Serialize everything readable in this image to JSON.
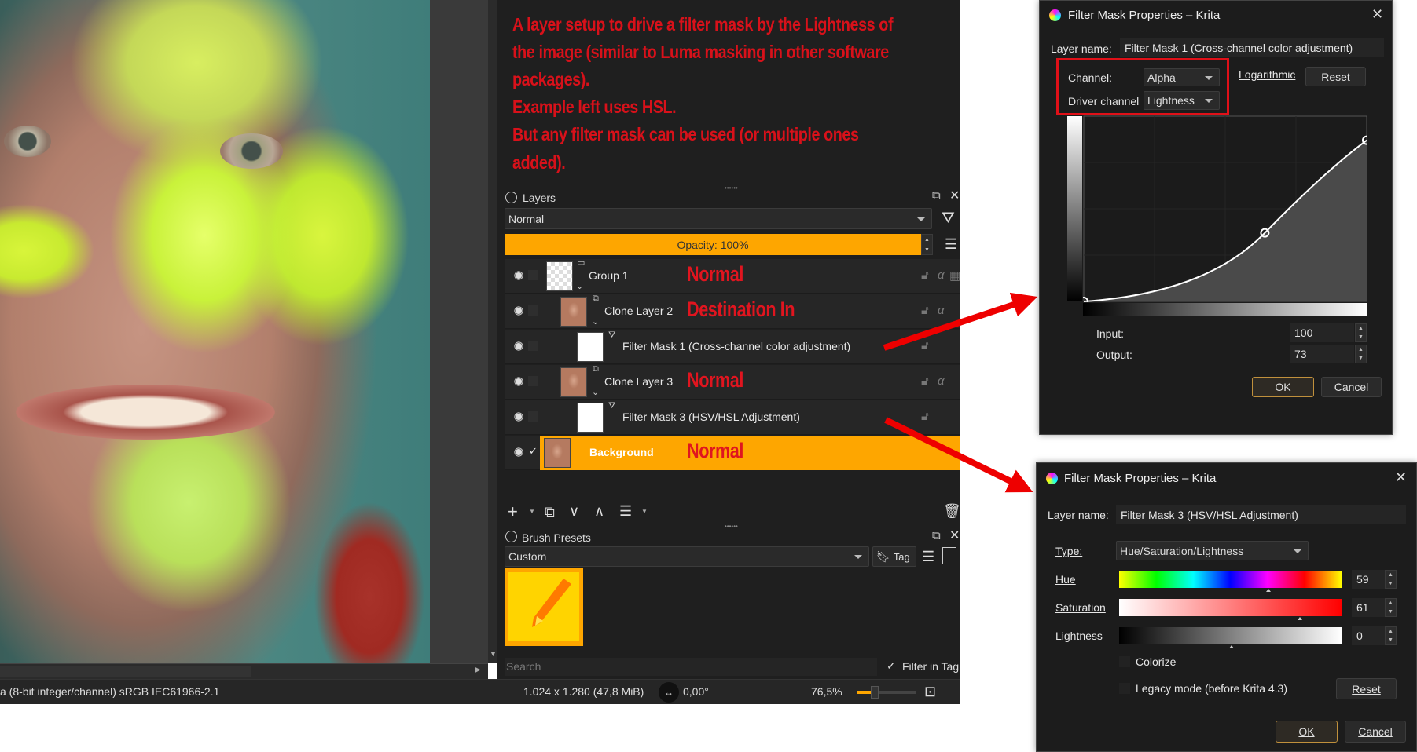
{
  "annotation": {
    "lines": [
      "A layer setup to drive a filter mask by the Lightness of",
      "the image (similar to Luma masking in other software",
      "packages).",
      "Example left uses HSL.",
      "But any filter mask can be used (or multiple ones",
      "added)."
    ]
  },
  "layers_panel": {
    "title": "Layers",
    "blend_mode": "Normal",
    "opacity_label": "Opacity:  100%",
    "opacity": 100,
    "layers": [
      {
        "name": "Group 1",
        "mode_note": "Normal",
        "type": "group"
      },
      {
        "name": "Clone Layer 2",
        "mode_note": "Destination In",
        "type": "clone"
      },
      {
        "name": "Filter Mask 1 (Cross-channel color adjustment)",
        "mode_note": "",
        "type": "filter-mask"
      },
      {
        "name": "Clone Layer 3",
        "mode_note": "Normal",
        "type": "clone"
      },
      {
        "name": "Filter Mask 3 (HSV/HSL Adjustment)",
        "mode_note": "",
        "type": "filter-mask"
      },
      {
        "name": "Background",
        "mode_note": "Normal",
        "type": "paint",
        "selected": true
      }
    ]
  },
  "brush_presets": {
    "title": "Brush Presets",
    "tag_filter": "Custom",
    "tag_button": "Tag",
    "search_placeholder": "Search",
    "filter_in_tag": "Filter in Tag",
    "filter_in_tag_checked": true
  },
  "status_bar": {
    "color_info": "a (8-bit integer/channel)  sRGB IEC61966-2.1",
    "dimensions": "1.024 x 1.280 (47,8 MiB)",
    "rotation": "0,00°",
    "zoom": "76,5%"
  },
  "dialog_cross_channel": {
    "title": "Filter Mask Properties – Krita",
    "layer_name_label": "Layer name:",
    "layer_name": "Filter Mask 1 (Cross-channel color adjustment)",
    "channel_label": "Channel:",
    "channel": "Alpha",
    "driver_label": "Driver channel",
    "driver": "Lightness",
    "logarithmic_label": "Logarithmic",
    "reset_label": "Reset",
    "curve_points": [
      [
        0,
        0
      ],
      [
        0.64,
        0.37
      ],
      [
        1,
        0.87
      ]
    ],
    "input_label": "Input:",
    "input_value": "100",
    "output_label": "Output:",
    "output_value": "73",
    "ok_label": "OK",
    "cancel_label": "Cancel"
  },
  "dialog_hsl": {
    "title": "Filter Mask Properties – Krita",
    "layer_name_label": "Layer name:",
    "layer_name": "Filter Mask 3 (HSV/HSL Adjustment)",
    "type_label": "Type:",
    "type": "Hue/Saturation/Lightness",
    "hue_label": "Hue",
    "hue_value": "59",
    "saturation_label": "Saturation",
    "saturation_value": "61",
    "lightness_label": "Lightness",
    "lightness_value": "0",
    "colorize_label": "Colorize",
    "legacy_label": "Legacy mode (before Krita 4.3)",
    "reset_label": "Reset",
    "ok_label": "OK",
    "cancel_label": "Cancel"
  },
  "colors": {
    "accent": "#fea600",
    "annotation": "#d8111a",
    "panel": "#1f1f1f"
  }
}
